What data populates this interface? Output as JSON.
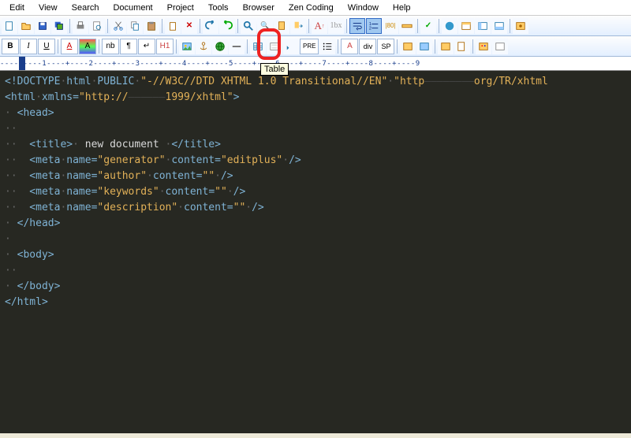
{
  "menu": {
    "items": [
      "Edit",
      "View",
      "Search",
      "Document",
      "Project",
      "Tools",
      "Browser",
      "Zen Coding",
      "Window",
      "Help"
    ]
  },
  "toolbar1_icons": [
    "new-file",
    "open-file",
    "save",
    "save-all",
    "print",
    "print-preview",
    "cut",
    "copy",
    "paste",
    "delete",
    "clipboard",
    "close",
    "undo",
    "redo",
    "search",
    "find-replace",
    "bookmark",
    "bookmark-next",
    "font-size",
    "outdent",
    "indent",
    "word-wrap",
    "line-number",
    "column",
    "ruler",
    "check",
    "browser-ie",
    "browser-view",
    "panel",
    "output",
    "settings"
  ],
  "toolbar2": {
    "bold": "B",
    "italic": "I",
    "underline": "U",
    "font": "A",
    "color": "A",
    "nb": "nb",
    "para": "¶",
    "break": "↵",
    "heading": "H1",
    "img": "img",
    "anchor": "anchor",
    "link": "link",
    "hr": "hr",
    "table": "table",
    "form": "form",
    "indent": "indent",
    "pre": "PRE",
    "list": "list",
    "charA": "A",
    "div": "div",
    "sp": "SP"
  },
  "tooltip": "Table",
  "ruler_text": "----+----1----+----2----+----3----+----4----+----5----+----6----+----7----+----8----+----9",
  "code": {
    "l1a": "<!DOCTYPE",
    "l1b": "html",
    "l1c": "PUBLIC",
    "l1d": "\"-//W3C//DTD XHTML 1.0 Transitional//EN\"",
    "l1e": "\"http",
    "l1f": "org/TR/xhtml",
    "l2a": "<html",
    "l2b": "xmlns=",
    "l2c": "\"http://",
    "l2d": "1999/xhtml\"",
    "l2e": ">",
    "l3": " <head>",
    "l4a": "  <title>",
    "l4b": " new document ",
    "l4c": "</title>",
    "l5a": "  <meta",
    "l5b": "name=",
    "l5c": "\"generator\"",
    "l5d": "content=",
    "l5e": "\"editplus\"",
    "l5f": "/>",
    "l6a": "  <meta",
    "l6b": "name=",
    "l6c": "\"author\"",
    "l6d": "content=",
    "l6e": "\"\"",
    "l6f": "/>",
    "l7a": "  <meta",
    "l7b": "name=",
    "l7c": "\"keywords\"",
    "l7d": "content=",
    "l7e": "\"\"",
    "l7f": "/>",
    "l8a": "  <meta",
    "l8b": "name=",
    "l8c": "\"description\"",
    "l8d": "content=",
    "l8e": "\"\"",
    "l8f": "/>",
    "l9": " </head>",
    "l10": "",
    "l11": " <body>",
    "l12": "  ",
    "l13": " </body>",
    "l14": "</html>"
  }
}
